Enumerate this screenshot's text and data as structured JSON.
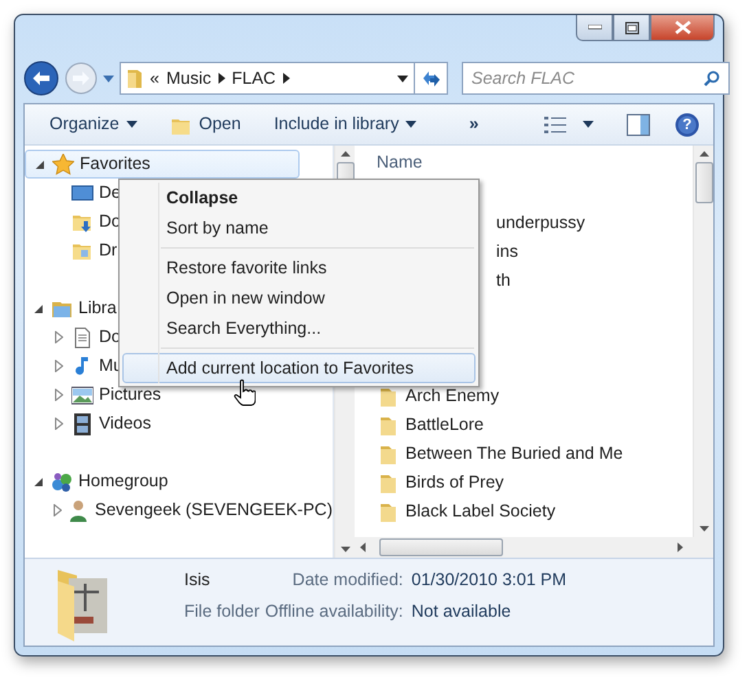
{
  "address": {
    "crumbs": [
      "«",
      "Music",
      "FLAC"
    ]
  },
  "search": {
    "placeholder": "Search FLAC"
  },
  "toolbar": [
    {
      "label": "Organize",
      "kind": "menu"
    },
    {
      "label": "Open",
      "kind": "open"
    },
    {
      "label": "Include in library",
      "kind": "menu"
    },
    {
      "label": "»",
      "kind": "overflow"
    }
  ],
  "help_button": {
    "label": "?"
  },
  "nav": [
    {
      "label": "Favorites",
      "kind": "star",
      "expanded": true,
      "selected": true,
      "children": [
        {
          "label": "De",
          "kind": "desktop",
          "selected": false
        },
        {
          "label": "Do",
          "kind": "downloads",
          "selected": false
        },
        {
          "label": "Dr",
          "kind": "folder",
          "selected": false
        }
      ]
    },
    {
      "label": "Libra",
      "kind": "library",
      "expanded": true,
      "selected": false,
      "children": [
        {
          "label": "Do",
          "kind": "document",
          "expanded": false,
          "selected": false
        },
        {
          "label": "Mu",
          "kind": "music",
          "expanded": false,
          "selected": false
        },
        {
          "label": "Pictures",
          "kind": "pictures",
          "expanded": false,
          "selected": false
        },
        {
          "label": "Videos",
          "kind": "videos",
          "expanded": false,
          "selected": false
        }
      ]
    },
    {
      "label": "Homegroup",
      "kind": "homegroup",
      "expanded": true,
      "selected": false,
      "children": [
        {
          "label": "Sevengeek (SEVENGEEK-PC)",
          "kind": "user",
          "expanded": false,
          "selected": false
        }
      ]
    }
  ],
  "file_list": {
    "column": "Name",
    "rows": [
      {
        "name": "underpussy",
        "kind": "partial"
      },
      {
        "name": "ins",
        "kind": "partial"
      },
      {
        "name": "th",
        "kind": "partial"
      },
      {
        "name": "Arch Enemy",
        "kind": "folder"
      },
      {
        "name": "BattleLore",
        "kind": "folder"
      },
      {
        "name": "Between The Buried and Me",
        "kind": "folder"
      },
      {
        "name": "Birds of Prey",
        "kind": "folder"
      },
      {
        "name": "Black Label Society",
        "kind": "folder"
      }
    ]
  },
  "context_menu": {
    "groups": [
      [
        {
          "label": "Collapse",
          "default": true,
          "highlighted": false
        },
        {
          "label": "Sort by name",
          "default": false,
          "highlighted": false
        }
      ],
      [
        {
          "label": "Restore favorite links",
          "default": false,
          "highlighted": false
        },
        {
          "label": "Open in new window",
          "default": false,
          "highlighted": false
        },
        {
          "label": "Search Everything...",
          "default": false,
          "highlighted": false
        }
      ],
      [
        {
          "label": "Add current location to Favorites",
          "default": false,
          "highlighted": true
        }
      ]
    ]
  },
  "details": {
    "name": "Isis",
    "type": "File folder",
    "properties": [
      {
        "label": "Date modified:",
        "value": "01/30/2010 3:01 PM"
      },
      {
        "label": "Offline availability:",
        "value": "Not available"
      }
    ]
  }
}
